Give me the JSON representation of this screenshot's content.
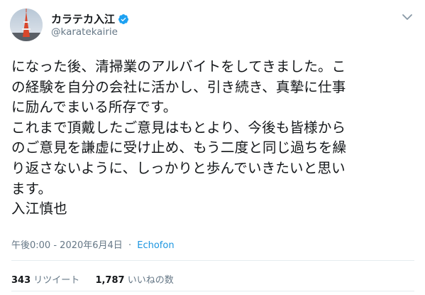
{
  "author": {
    "display_name": "カラテカ入江",
    "handle": "@karatekairie",
    "verified": true,
    "avatar_icon": "tokyo-tower-avatar-icon"
  },
  "tweet": {
    "lines": [
      "になった後、清掃業のアルバイトをしてきました。こ",
      "の経験を自分の会社に活かし、引き続き、真摯に仕事",
      "に励んでまいる所存です。",
      "これまで頂戴したご意見はもとより、今後も皆様から",
      "のご意見を謙虚に受け止め、もう二度と同じ過ちを繰",
      "り返さないように、しっかりと歩んでいきたいと思い",
      "ます。",
      "入江慎也"
    ],
    "time": "午後0:00",
    "separator": "·",
    "date": "2020年6月4日",
    "source": "Echofon"
  },
  "stats": {
    "retweets_count": "343",
    "retweets_label": "リツイート",
    "likes_count": "1,787",
    "likes_label": "いいねの数"
  },
  "colors": {
    "text": "#14171a",
    "muted": "#657786",
    "link": "#1b95e0",
    "verified": "#1da1f2",
    "divider": "#e6ecf0"
  }
}
